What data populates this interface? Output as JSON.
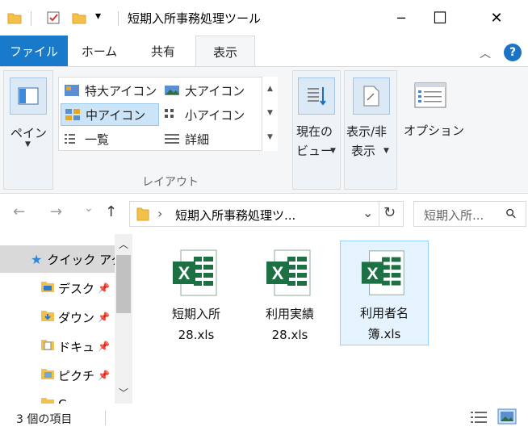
{
  "title_bar": {
    "title": "短期入所事務処理ツール",
    "minimize_glyph": "─",
    "maximize_glyph": "☐",
    "close_glyph": "✕",
    "qa_dropdown_glyph": "▾"
  },
  "ribbon_tabs": {
    "file": "ファイル",
    "home": "ホーム",
    "share": "共有",
    "view": "表示",
    "help_glyph": "?",
    "collapse_glyph": "︿"
  },
  "ribbon": {
    "pane_label": "ペイン",
    "layout_items": [
      {
        "label": "特大アイコン"
      },
      {
        "label": "大アイコン"
      },
      {
        "label": "中アイコン"
      },
      {
        "label": "小アイコン"
      },
      {
        "label": "一覧"
      },
      {
        "label": "詳細"
      }
    ],
    "layout_caption": "レイアウト",
    "current_view_line1": "現在の",
    "current_view_line2": "ビュー",
    "show_hide_line1": "表示/非",
    "show_hide_line2": "表示",
    "options_label": "オプション"
  },
  "navigation": {
    "back_glyph": "←",
    "forward_glyph": "→",
    "history_glyph": "⌄",
    "up_glyph": "↑",
    "address_path": "短期入所事務処理ツ...",
    "address_sep_glyph": "›",
    "address_dropdown_glyph": "⌄",
    "refresh_glyph": "↻",
    "search_placeholder": "短期入所...",
    "search_glyph": "⚲"
  },
  "nav_pane": {
    "quick_access": "クイック アク",
    "items": [
      {
        "label": "デスク"
      },
      {
        "label": "ダウン"
      },
      {
        "label": "ドキュ"
      },
      {
        "label": "ピクチ"
      },
      {
        "label": "C"
      }
    ],
    "pin_glyph": "📌"
  },
  "files": [
    {
      "line1": "短期入所",
      "line2": "28.xls"
    },
    {
      "line1": "利用実績",
      "line2": "28.xls"
    },
    {
      "line1": "利用者名",
      "line2": "簿.xls"
    }
  ],
  "status_bar": {
    "item_count": "3 個の項目"
  },
  "colors": {
    "accent": "#1979ca",
    "excel_green": "#1d7044",
    "selection": "#cce4f7"
  }
}
